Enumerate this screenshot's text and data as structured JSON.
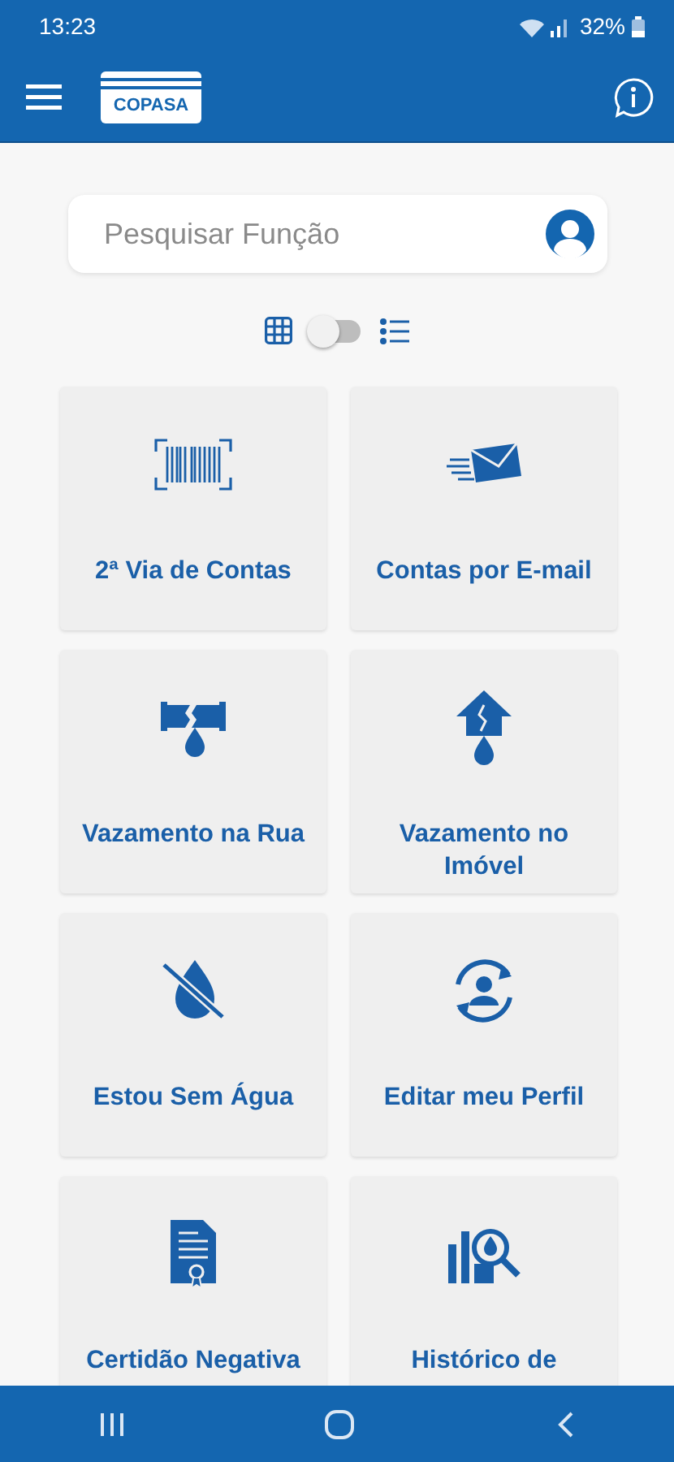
{
  "status_bar": {
    "time": "13:23",
    "battery": "32%"
  },
  "app_bar": {
    "logo": "COPASA"
  },
  "search": {
    "placeholder": "Pesquisar Função"
  },
  "view_toggle": {
    "on": false
  },
  "functions": [
    {
      "label": "2ª Via de Contas"
    },
    {
      "label": "Contas por E-mail"
    },
    {
      "label": "Vazamento na Rua"
    },
    {
      "label": "Vazamento no Imóvel"
    },
    {
      "label": "Estou Sem Água"
    },
    {
      "label": "Editar meu Perfil"
    },
    {
      "label": "Certidão Negativa"
    },
    {
      "label": "Histórico de"
    }
  ]
}
